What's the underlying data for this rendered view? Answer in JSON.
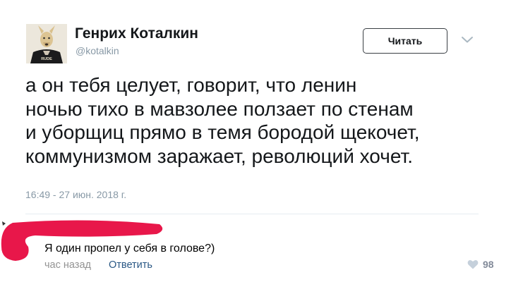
{
  "tweet": {
    "author": {
      "name": "Генрих Коталкин",
      "handle": "@kotalkin",
      "avatar_icon": "dog-headed-person-avatar",
      "avatar_shirt_text": "RUDE"
    },
    "follow_label": "Читать",
    "menu_icon": "chevron-down-icon",
    "text_lines": [
      "а он тебя целует, говорит, что ленин",
      "ночью тихо в мавзолее ползает по стенам",
      "и уборщиц прямо в темя бородой щекочет,",
      "коммунизмом заражает, революций хочет."
    ],
    "timestamp": "16:49 - 27 июн. 2018 г."
  },
  "comment": {
    "text": "Я один пропел у себя в голове?)",
    "time": "час назад",
    "reply_label": "Ответить",
    "like_icon": "heart-icon",
    "likes": "98",
    "redaction_color": "#e8174a"
  },
  "colors": {
    "text": "#14171a",
    "muted": "#8899a6",
    "link": "#2a5885",
    "like": "#828a99"
  }
}
